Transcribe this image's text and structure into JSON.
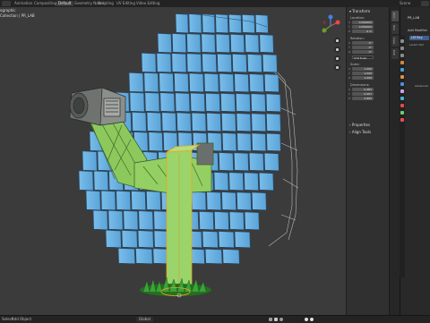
{
  "topbar": {
    "tabs": [
      {
        "label": "Animation",
        "active": false
      },
      {
        "label": "Compositing",
        "active": false
      },
      {
        "label": "Default",
        "active": true
      },
      {
        "label": "Geometry Nodes",
        "active": false
      },
      {
        "label": "Scripting",
        "active": false
      },
      {
        "label": "UV Editing",
        "active": false
      },
      {
        "label": "Video Editing",
        "active": false
      }
    ],
    "scene_label": "Scene"
  },
  "viewport": {
    "overlay_line1": "ographic",
    "overlay_line2": "Collection | PR_LAB"
  },
  "npanel": {
    "transform_header": "Transform",
    "location_label": "Location:",
    "location": [
      "0.000000",
      "0.000000",
      "0 m"
    ],
    "rotation_label": "Rotation:",
    "rotation": [
      "0°",
      "0°",
      "0°"
    ],
    "rotation_mode": "XYZ Euler",
    "scale_label": "Scale:",
    "scale": [
      "1.000",
      "1.000",
      "1.000"
    ],
    "dimensions_label": "Dimensions:",
    "dimensions": [
      "0.481",
      "0.067",
      "2.895"
    ],
    "axes": [
      "X",
      "Y",
      "Z"
    ],
    "properties_header": "Properties",
    "align_tools_header": "Align Tools"
  },
  "vtabs": [
    "Item",
    "Tool",
    "View",
    "Edit"
  ],
  "outliner": {
    "object_name": "PR_LAB",
    "modifier_label": "Add Modifier",
    "modifier_item": "LM Ray",
    "row2": "Lorem Voll",
    "advanced_label": "Advanced"
  },
  "statusbar": {
    "select_label": "Select",
    "add_label": "Add",
    "object_label": "Object",
    "pivot_label": "Global"
  },
  "colors": {
    "mirror": "#6ab2e6",
    "frame": "#8dc85d",
    "selection": "#f0a020",
    "grass": "#2f8f2f"
  }
}
